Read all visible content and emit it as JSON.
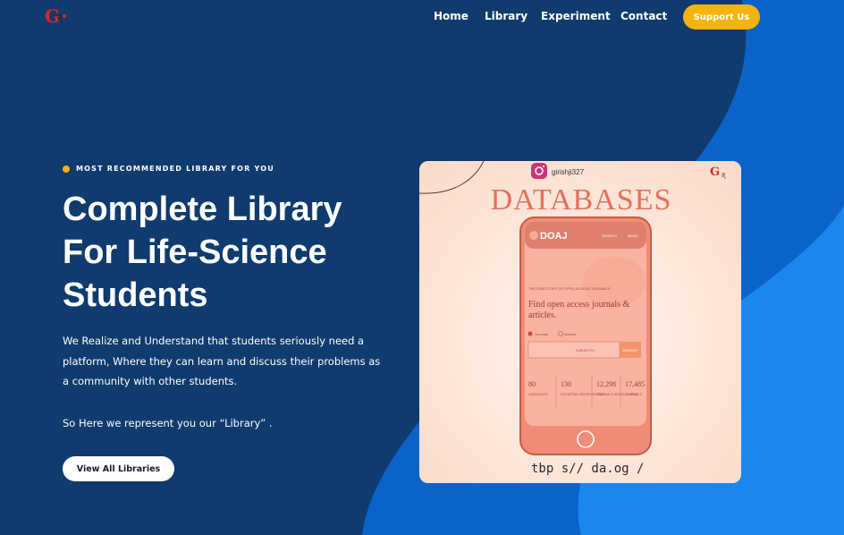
{
  "brand": {
    "logo_letter": "G",
    "logo_rest": "त्"
  },
  "nav": {
    "items": [
      {
        "label": "Home"
      },
      {
        "label": "Library"
      },
      {
        "label": "Experiment"
      },
      {
        "label": "Contact"
      }
    ],
    "support_label": "Support Us"
  },
  "hero": {
    "eyebrow": "MOST RECOMMENDED LIBRARY FOR YOU",
    "title": "Complete Library For Life-Science Students",
    "description": "We Realize and Understand that students seriously need a platform, Where they can learn and discuss their problems as a community with other students.",
    "note": "So Here we represent you our “Library” .",
    "cta_label": "View All Libraries"
  },
  "card": {
    "instagram_handle": "girishji327",
    "heading": "DATABASES",
    "doaj_logo": "DOAJ",
    "doaj_nav_search": "SEARCH",
    "doaj_nav_menu": "MENU",
    "doaj_tagline": "THE DIRECTORY OF OPEN ACCESS JOURNALS",
    "doaj_heading": "Find open access journals & articles.",
    "radio_journals": "Journals",
    "radio_articles": "Articles",
    "select_label": "SUBJECTS",
    "search_btn": "SEARCH",
    "stats": [
      {
        "value": "80",
        "label": "LANGUAGES"
      },
      {
        "value": "130",
        "label": "COUNTRIES REPRESENTED"
      },
      {
        "value": "12,298",
        "label": "JOURNALS WITHOUT APCS"
      },
      {
        "value": "17,485",
        "label": "JOURNALS"
      }
    ],
    "footer_url": "tbp s// da.og /"
  },
  "colors": {
    "bg": "#0f3b6e",
    "accent": "#f3b40f",
    "blob": "#0a63c9",
    "blob_light": "#1b86f0"
  },
  "icons": {
    "instagram": "instagram-icon",
    "logo": "logo-icon"
  }
}
